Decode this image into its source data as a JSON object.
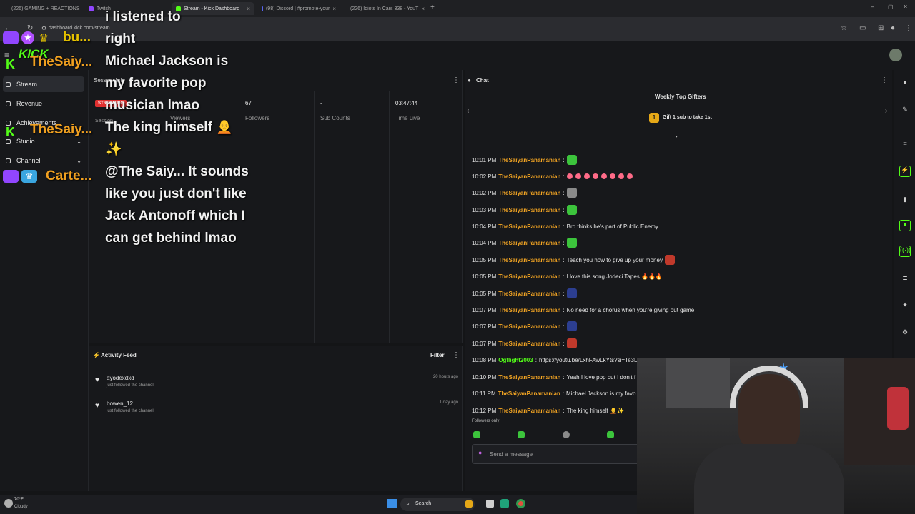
{
  "browser": {
    "tabs": [
      {
        "label": "(226) GAMING + REACTIONS",
        "color": "#ff0000"
      },
      {
        "label": "Twitch",
        "color": "#9146ff"
      },
      {
        "label": "Stream - Kick Dashboard",
        "color": "#53fc18"
      },
      {
        "label": "(98) Discord | #promote-your",
        "color": "#5865f2"
      },
      {
        "label": "(226) Idiots In Cars 338 - YouT",
        "color": "#ff0000"
      }
    ],
    "url": "dashboard.kick.com/stream",
    "new_tab_icon": "plus-icon"
  },
  "sidebar": {
    "items": [
      {
        "label": "Stream",
        "icon": "stream-icon"
      },
      {
        "label": "Revenue",
        "icon": "revenue-icon"
      },
      {
        "label": "Achievements",
        "icon": "achievements-icon"
      },
      {
        "label": "Studio",
        "icon": "studio-icon"
      },
      {
        "label": "Channel",
        "icon": "channel-icon"
      }
    ]
  },
  "session": {
    "title": "Session Info",
    "status_badge": "STREAMING",
    "session_label": "Session",
    "viewers_label": "Viewers",
    "followers_value": "67",
    "followers_label": "Followers",
    "sub_value": "-",
    "sub_label": "Sub Counts",
    "time_value": "03:47:44",
    "time_label": "Time Live"
  },
  "activity": {
    "title": "Activity Feed",
    "filter_label": "Filter",
    "items": [
      {
        "name": "ayodexdxd",
        "action": "just followed the channel",
        "time": "20 hours ago"
      },
      {
        "name": "bowen_12",
        "action": "just followed the channel",
        "time": "1 day ago"
      }
    ]
  },
  "chat": {
    "title": "Chat",
    "top_gifters_title": "Weekly Top Gifters",
    "gift_prompt": "Gift 1 sub to take 1st",
    "gift_rank": "1",
    "messages": [
      {
        "time": "10:01 PM",
        "user": "TheSaiyanPanamanian",
        "text": "",
        "emote": "#3cc43c"
      },
      {
        "time": "10:02 PM",
        "user": "TheSaiyanPanamanian",
        "text": "",
        "hearts": 8
      },
      {
        "time": "10:02 PM",
        "user": "TheSaiyanPanamanian",
        "text": "",
        "emote": "#8a8a8a"
      },
      {
        "time": "10:03 PM",
        "user": "TheSaiyanPanamanian",
        "text": "",
        "emote": "#3cc43c"
      },
      {
        "time": "10:04 PM",
        "user": "TheSaiyanPanamanian",
        "text": "Bro thinks he's part of Public Enemy"
      },
      {
        "time": "10:04 PM",
        "user": "TheSaiyanPanamanian",
        "text": "",
        "emote": "#3cc43c"
      },
      {
        "time": "10:05 PM",
        "user": "TheSaiyanPanamanian",
        "text": "Teach you how to give up your money",
        "emote": "#c0392b"
      },
      {
        "time": "10:05 PM",
        "user": "TheSaiyanPanamanian",
        "text": "I love this song Jodeci Tapes 🔥🔥🔥"
      },
      {
        "time": "10:05 PM",
        "user": "TheSaiyanPanamanian",
        "text": "",
        "emote": "#2c3e90"
      },
      {
        "time": "10:07 PM",
        "user": "TheSaiyanPanamanian",
        "text": "No need for a chorus when you're giving out game"
      },
      {
        "time": "10:07 PM",
        "user": "TheSaiyanPanamanian",
        "text": "",
        "emote": "#2c3e90"
      },
      {
        "time": "10:07 PM",
        "user": "TheSaiyanPanamanian",
        "text": "",
        "emote": "#c0392b"
      },
      {
        "time": "10:08 PM",
        "user": "Ogflight2003",
        "text": "https://youtu.be/LxhFAwLkYts?si=Te3Lz_XLddUKahfv",
        "link": true,
        "green": true
      },
      {
        "time": "10:10 PM",
        "user": "TheSaiyanPanamanian",
        "text": "Yeah I love pop but I don't f"
      },
      {
        "time": "10:11 PM",
        "user": "TheSaiyanPanamanian",
        "text": "Michael Jackson is my favo"
      },
      {
        "time": "10:12 PM",
        "user": "TheSaiyanPanamanian",
        "text": "The king himself 🧑‍🦲✨"
      }
    ],
    "followers_only": "Followers only",
    "placeholder": "Send a message"
  },
  "overlay": {
    "lines": [
      "i listened to",
      "right",
      "Michael Jackson is",
      "my favorite pop",
      "musician lmao",
      "The king himself 🧑‍🦲",
      "✨",
      "@The Saiy... It sounds",
      "like you just don't like",
      "Jack Antonoff which I",
      "can get behind lmao"
    ],
    "users": [
      {
        "label": "bu...",
        "color": "#e6c200"
      },
      {
        "label": "TheSaiy...",
        "color": "#f0a020"
      },
      {
        "label": "TheSaiy...",
        "color": "#f0a020"
      },
      {
        "label": "Carte...",
        "color": "#f0a020"
      }
    ],
    "kick_logo": "KICK"
  },
  "taskbar": {
    "weather_temp": "70°F",
    "weather_desc": "Cloudy",
    "search_label": "Search"
  }
}
